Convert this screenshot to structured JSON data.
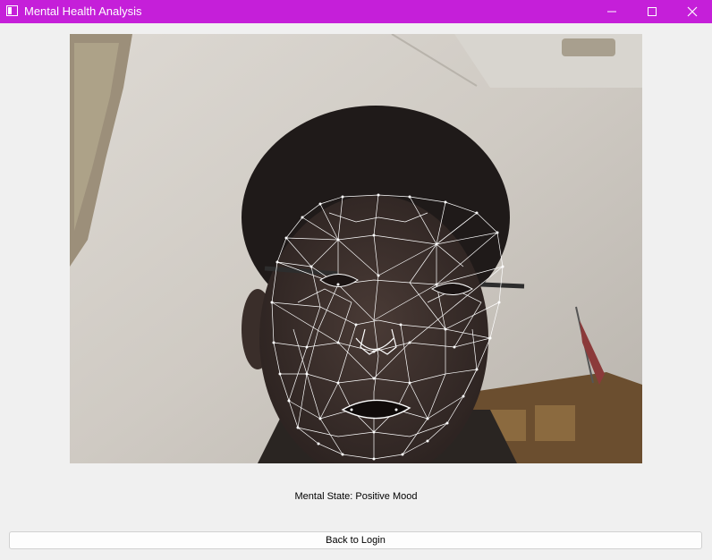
{
  "window": {
    "title": "Mental Health Analysis",
    "titlebar_color": "#c51fd9",
    "controls": [
      "minimize-icon",
      "maximize-icon",
      "close-icon"
    ]
  },
  "camera": {
    "overlay": "face-mesh",
    "overlay_color": "#ffffff"
  },
  "status": {
    "text": "Mental State: Positive Mood"
  },
  "actions": {
    "back_label": "Back to Login"
  }
}
